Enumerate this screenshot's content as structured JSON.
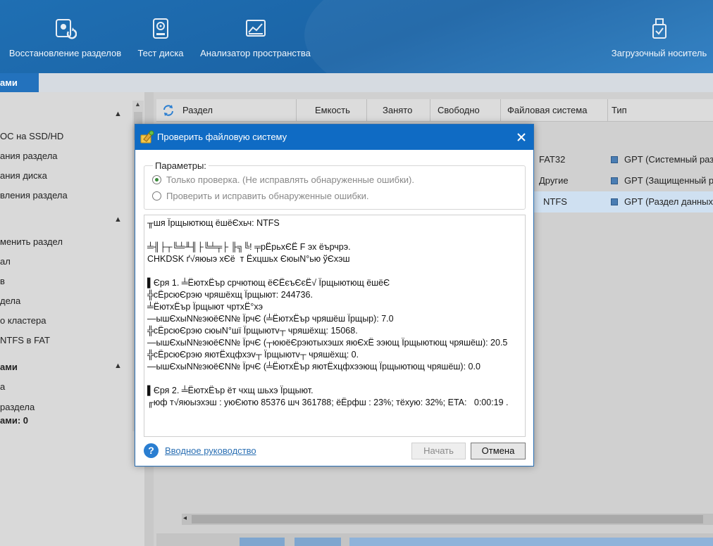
{
  "toolbar": {
    "items": [
      {
        "label": "Восстановление разделов",
        "icon": "partition-recovery-icon"
      },
      {
        "label": "Тест диска",
        "icon": "disk-test-icon"
      },
      {
        "label": "Анализатор пространства",
        "icon": "space-analyzer-icon"
      },
      {
        "label": "Загрузочный носитель",
        "icon": "bootable-media-icon"
      }
    ]
  },
  "left_panel": {
    "tab_label": "ами",
    "groups": [
      {
        "items": [
          "ОС на SSD/HD",
          "ания раздела",
          "ания диска",
          "вления раздела"
        ]
      },
      {
        "items": [
          "менить раздел",
          "ал",
          "в",
          "дела",
          "о кластера",
          "NTFS в FAT"
        ]
      },
      {
        "header": "ами",
        "items": [
          "а",
          "раздела"
        ],
        "footer": "ами: 0"
      }
    ]
  },
  "table": {
    "columns": [
      "Раздел",
      "Емкость",
      "Занято",
      "Свободно",
      "Файловая система",
      "Тип"
    ],
    "rows": [
      {
        "fs": "FAT32",
        "type": "GPT (Системный разд"
      },
      {
        "fs": "Другие",
        "type": "GPT (Защищенный ра"
      },
      {
        "fs": "NTFS",
        "type": "GPT (Раздел данных)"
      }
    ]
  },
  "dialog": {
    "title": "Проверить файловую систему",
    "params_label": "Параметры:",
    "options": [
      {
        "label": "Только проверка. (Не исправлять обнаруженные ошибки).",
        "selected": true
      },
      {
        "label": "Проверить и исправить обнаруженные ошибки.",
        "selected": false
      }
    ],
    "log": [
      "╥шя Їрщыютющ ёшёЄхьч: NTFS",
      "",
      "╧╢├┬╚╧╨╢├╚╧╤├ ╟╗╚! ╤рЁрьхЄЁ F эх ёърчрэ.",
      "CHKDSK ґ√яюыэ хЄё  т Ёхцшьх ЄюыN°ью ўЄхэш",
      "",
      "▌Єря 1. ╧ЁютхЁър срчютющ ёЄЁєъЄєЁ√ Їрщыютющ ёшёЄ",
      "╬сЁрсюЄрэю чряшёхщ Їрщыют: 244736.",
      "╧ЁютхЁър Їрщыют чртхЁ°хэ",
      "—ышЄхыN№эюёЄN№ ЇрчЄ (╧ЁютхЁър чряшёш Їрщыр): 7.0",
      "╬сЁрсюЄрэю сюыN°шї Їрщыютv┬ чряшёхщ: 15068.",
      "—ышЄхыN№эюёЄN№ ЇрчЄ (┬ююёЄрэютыхэшх яюЄхЁ ээющ Їрщыютющ чряшёш): 20.5",
      "╬сЁрсюЄрэю яютЁхцфхэv┬ Їрщыютv┬ чряшёхщ: 0.",
      "—ышЄхыN№эюёЄN№ ЇрчЄ (╧ЁютхЁър яютЁхцфхээющ Їрщыютющ чряшёш): 0.0",
      "",
      "▌Єря 2. ╧ЁютхЁър ёт чхщ шьхэ Їрщыют.",
      "╓юф т√яюыэхэш : уюЄютю 85376 шч 361788; ёЁрфш : 23%; тёхую: 32%; ETA:   0:00:19 ."
    ],
    "help_link": "Вводное руководство",
    "start_label": "Начать",
    "cancel_label": "Отмена"
  },
  "colors": {
    "toolbar_bg": "#1b64a6",
    "dialog_title_bg": "#0f6bc4",
    "selected_row_bg": "#cfe0f1"
  }
}
